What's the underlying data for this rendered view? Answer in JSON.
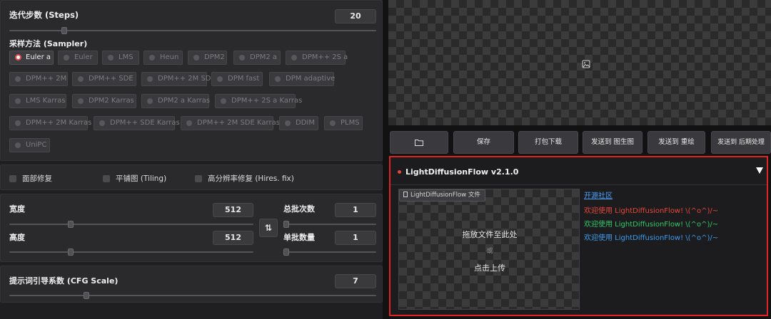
{
  "steps": {
    "label": "迭代步数 (Steps)",
    "value": "20",
    "fraction": 0.15
  },
  "sampler": {
    "label": "采样方法 (Sampler)",
    "selected": "Euler a",
    "options": [
      "Euler a",
      "Euler",
      "LMS",
      "Heun",
      "DPM2",
      "DPM2 a",
      "DPM++ 2S a",
      "DPM++ 2M",
      "DPM++ SDE",
      "DPM++ 2M SDE",
      "DPM fast",
      "DPM adaptive",
      "LMS Karras",
      "DPM2 Karras",
      "DPM2 a Karras",
      "DPM++ 2S a Karras",
      "DPM++ 2M Karras",
      "DPM++ SDE Karras",
      "DPM++ 2M SDE Karras",
      "DDIM",
      "PLMS",
      "UniPC"
    ]
  },
  "options_row": {
    "face_restore": "面部修复",
    "tiling": "平铺图 (Tiling)",
    "hires_fix": "高分辨率修复 (Hires. fix)"
  },
  "size": {
    "width_label": "宽度",
    "width_value": "512",
    "width_fraction": 0.25,
    "height_label": "高度",
    "height_value": "512",
    "height_fraction": 0.25,
    "batch_count_label": "总批次数",
    "batch_count_value": "1",
    "batch_size_label": "单批数量",
    "batch_size_value": "1"
  },
  "cfg": {
    "label": "提示词引导系数 (CFG Scale)",
    "value": "7",
    "fraction": 0.21
  },
  "actions": {
    "folder_icon": "folder-icon",
    "save": "保存",
    "zip": "打包下载",
    "to_img2img": "发送到 图生图",
    "to_inpaint": "发送到 重绘",
    "to_extras": "发送到 后期处理"
  },
  "ldf": {
    "title": "LightDiffusionFlow v2.1.0",
    "file_label": "LightDiffusionFlow 文件",
    "drop_text": "拖放文件至此处",
    "or_text": "或",
    "click_text": "点击上传",
    "community_link": "开源社区",
    "welcome_1": "欢迎使用 LightDiffusionFlow! \\(^o^)/~",
    "welcome_2": "欢迎使用 LightDiffusionFlow! \\(^o^)/~",
    "welcome_3": "欢迎使用 LightDiffusionFlow! \\(^o^)/~"
  },
  "colors": {
    "accent_red": "#e02424",
    "welcome_1": "#e8473c",
    "welcome_2": "#35c86a",
    "welcome_3": "#3d9df0",
    "link": "#4aa3ff"
  }
}
